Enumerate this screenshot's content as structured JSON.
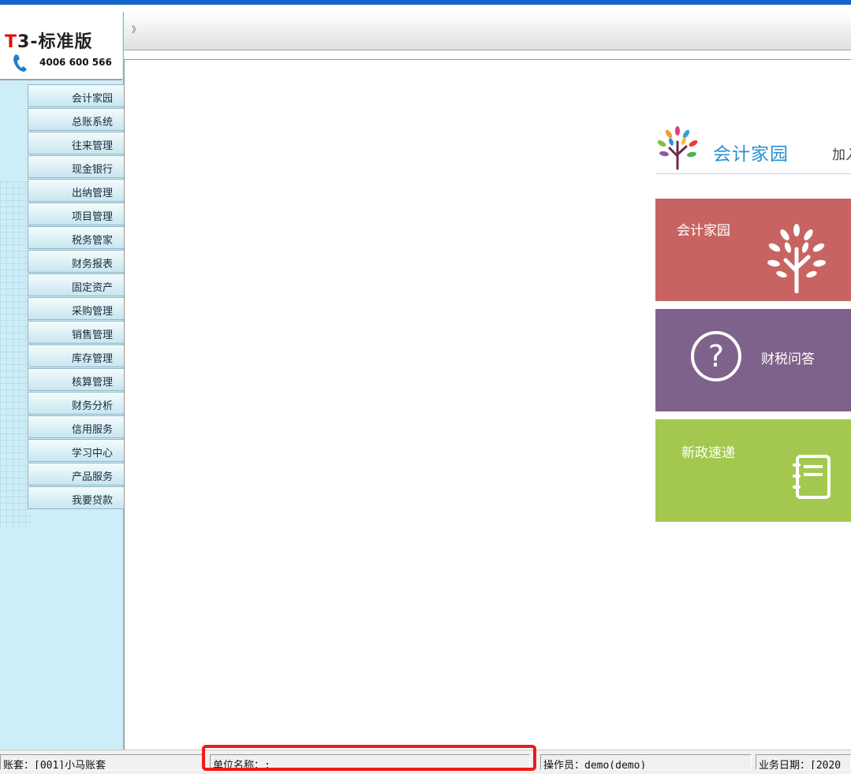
{
  "logo": {
    "brand_t": "T",
    "brand_rest": "3-标准版",
    "phone": "4006 600 566"
  },
  "sidebar": {
    "items": [
      {
        "label": "会计家园"
      },
      {
        "label": "总账系统"
      },
      {
        "label": "往来管理"
      },
      {
        "label": "现金银行"
      },
      {
        "label": "出纳管理"
      },
      {
        "label": "项目管理"
      },
      {
        "label": "税务管家"
      },
      {
        "label": "财务报表"
      },
      {
        "label": "固定资产"
      },
      {
        "label": "采购管理"
      },
      {
        "label": "销售管理"
      },
      {
        "label": "库存管理"
      },
      {
        "label": "核算管理"
      },
      {
        "label": "财务分析"
      },
      {
        "label": "信用服务"
      },
      {
        "label": "学习中心"
      },
      {
        "label": "产品服务"
      },
      {
        "label": "我要贷款"
      }
    ]
  },
  "toolbar": {
    "expand_glyph": "》"
  },
  "main": {
    "site_name": "会计家园",
    "join_text": "加入",
    "tiles": [
      {
        "label": "会计家园",
        "color": "#c76462"
      },
      {
        "label": "财税问答",
        "color": "#7f628b"
      },
      {
        "label": "新政速递",
        "color": "#a4c84f"
      }
    ]
  },
  "statusbar": {
    "account": "账套：[001]小马账套",
    "unit": "单位名称：:",
    "operator": "操作员：demo(demo)",
    "date": "业务日期：[2020"
  },
  "colors": {
    "menubar": "#1565c9",
    "sidebar_bg": "#cdeef8",
    "highlight": "#ee1a1a",
    "site_name": "#2a8fd4"
  }
}
